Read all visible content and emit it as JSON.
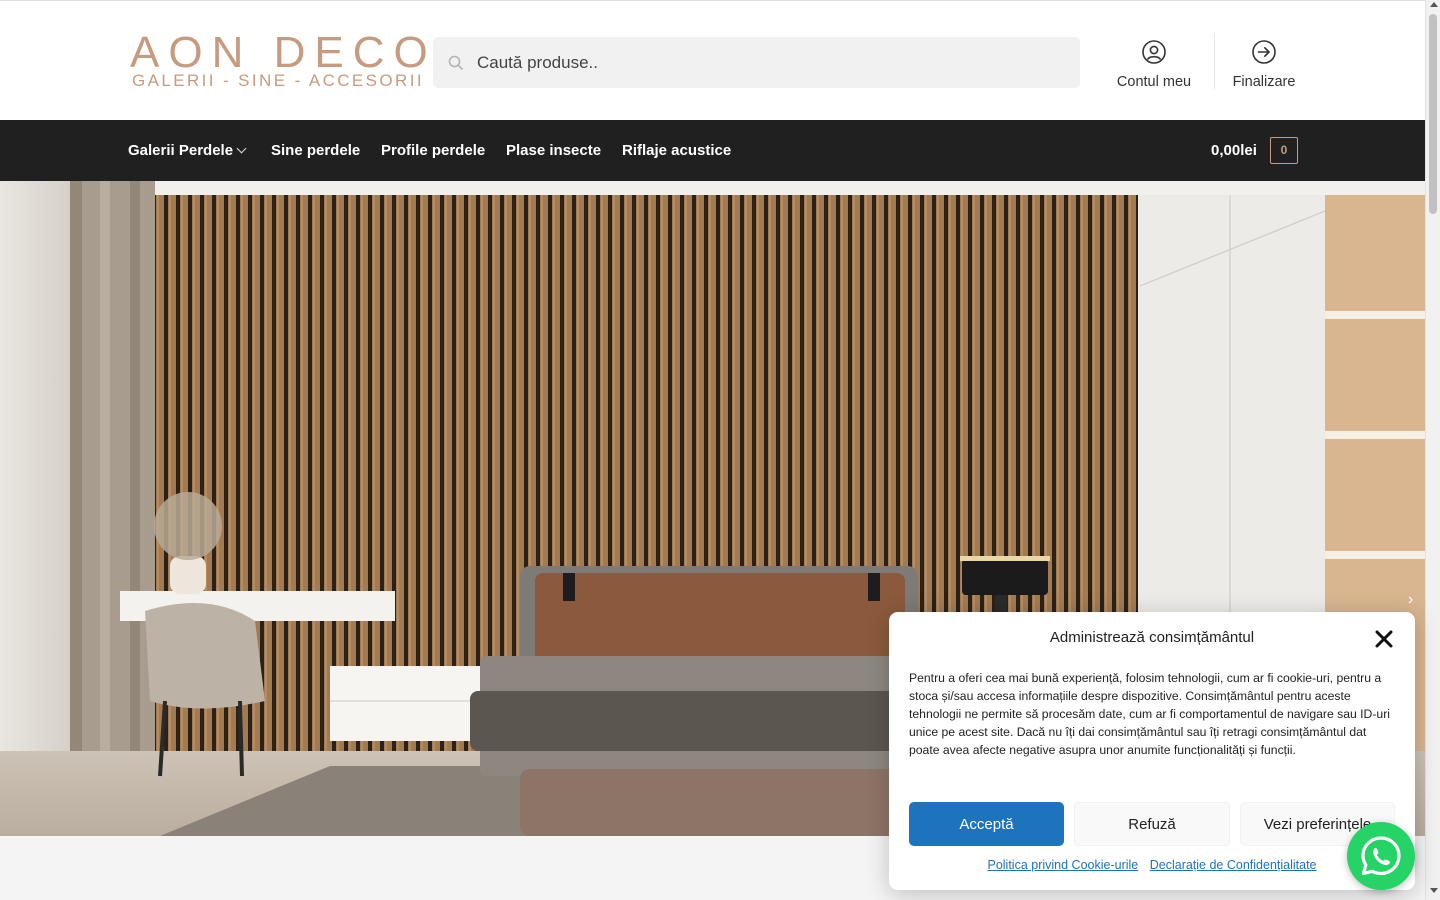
{
  "header": {
    "logo_main": "AON DECO",
    "logo_sub": "GALERII - SINE - ACCESORII",
    "search_placeholder": "Caută produse..",
    "account_label": "Contul meu",
    "checkout_label": "Finalizare"
  },
  "nav": {
    "items": [
      {
        "label": "Galerii Perdele",
        "has_dropdown": true
      },
      {
        "label": "Sine perdele"
      },
      {
        "label": "Profile perdele"
      },
      {
        "label": "Plase insecte"
      },
      {
        "label": "Riflaje acustice"
      }
    ],
    "cart_total": "0,00lei",
    "cart_count": "0"
  },
  "hero": {
    "next_arrow": "›"
  },
  "cookie": {
    "title": "Administrează consimțământul",
    "text": "Pentru a oferi cea mai bună experiență, folosim tehnologii, cum ar fi cookie-uri, pentru a stoca și/sau accesa informațiile despre dispozitive. Consimțământul pentru aceste tehnologii ne permite să procesăm date, cum ar fi comportamentul de navigare sau ID-uri unice pe acest site. Dacă nu îți dai consimțământul sau îți retragi consimțământul dat poate avea afecte negative asupra unor anumite funcționalități și funcții.",
    "accept": "Acceptă",
    "deny": "Refuză",
    "preferences": "Vezi preferințele",
    "link_cookie_policy": "Politica privind Cookie-urile",
    "link_privacy": "Declarație de Confidențialitate"
  },
  "colors": {
    "brand": "#c69b7f",
    "nav_bg": "#202020",
    "accept_button": "#1e73be",
    "whatsapp": "#25d366"
  },
  "icons": {
    "search": "search-icon",
    "account": "user-circle-icon",
    "checkout": "arrow-right-circle-icon",
    "close": "close-icon",
    "whatsapp": "whatsapp-icon"
  }
}
